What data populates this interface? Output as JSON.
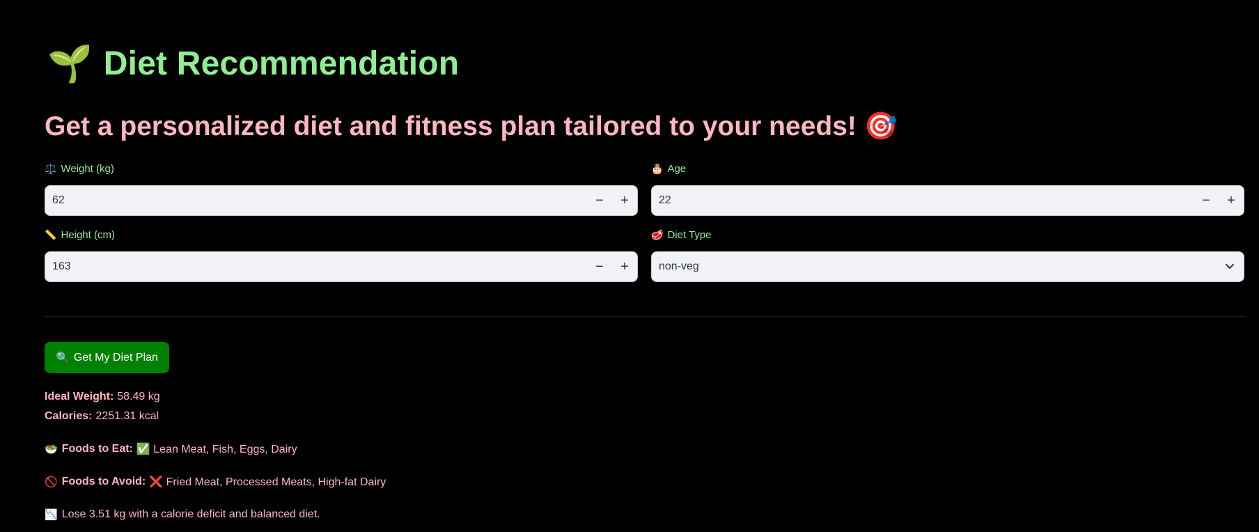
{
  "header": {
    "title_emoji": "🌱",
    "title": "Diet Recommendation",
    "subtitle": "Get a personalized diet and fitness plan tailored to your needs! 🎯"
  },
  "form": {
    "weight": {
      "emoji": "⚖️",
      "label": "Weight (kg)",
      "value": "62"
    },
    "age": {
      "emoji": "🎂",
      "label": "Age",
      "value": "22"
    },
    "height": {
      "emoji": "📏",
      "label": "Height (cm)",
      "value": "163"
    },
    "diet_type": {
      "emoji": "🥩",
      "label": "Diet Type",
      "value": "non-veg"
    },
    "minus": "−",
    "plus": "+"
  },
  "button": {
    "emoji": "🔍",
    "label": "Get My Diet Plan"
  },
  "results": {
    "ideal_weight_label": "Ideal Weight:",
    "ideal_weight_value": "58.49 kg",
    "calories_label": "Calories:",
    "calories_value": "2251.31 kcal",
    "eat_emoji": "🥗",
    "eat_label": "Foods to Eat:",
    "eat_value": "✅ Lean Meat, Fish, Eggs, Dairy",
    "avoid_emoji": "🚫",
    "avoid_label": "Foods to Avoid:",
    "avoid_value": "❌ Fried Meat, Processed Meats, High-fat Dairy",
    "goal_emoji": "📉",
    "goal_text": "Lose 3.51 kg with a calorie deficit and balanced diet."
  },
  "colors": {
    "background": "#000000",
    "title": "#90EE90",
    "subtitle": "#FFB6C1",
    "input_bg": "#F0F2F6",
    "button": "#008000"
  }
}
